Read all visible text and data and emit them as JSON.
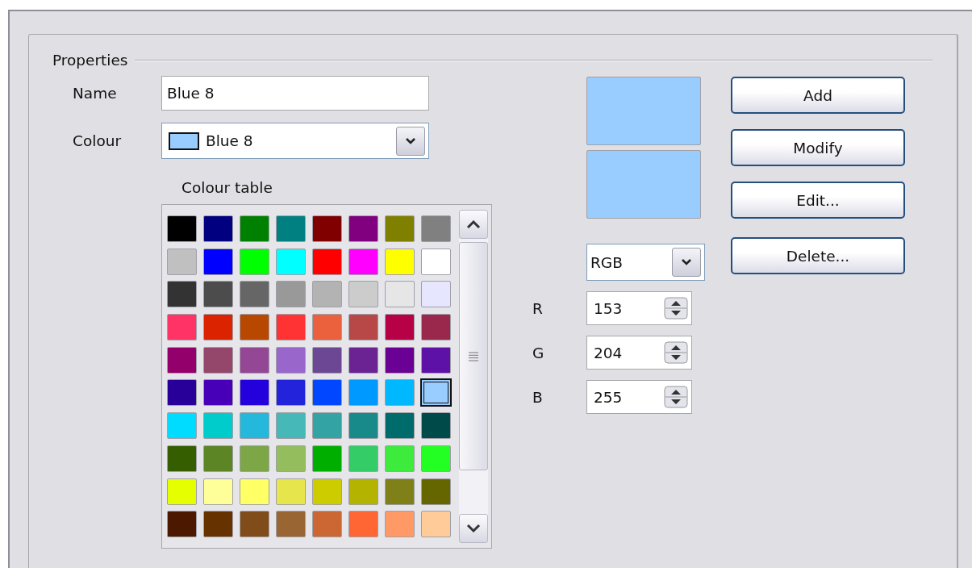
{
  "group": {
    "title": "Properties"
  },
  "name_field": {
    "label": "Name",
    "value": "Blue 8"
  },
  "colour_dropdown": {
    "label": "Colour",
    "value": "Blue 8",
    "color": "#99ccff"
  },
  "colour_table": {
    "label": "Colour table",
    "rows": [
      {
        "cells": [
          {
            "color": "#000000",
            "selected": false
          },
          {
            "color": "#000080",
            "selected": false
          },
          {
            "color": "#008000",
            "selected": false
          },
          {
            "color": "#008080",
            "selected": false
          },
          {
            "color": "#800000",
            "selected": false
          },
          {
            "color": "#800080",
            "selected": false
          },
          {
            "color": "#808000",
            "selected": false
          },
          {
            "color": "#808080",
            "selected": false
          }
        ]
      },
      {
        "cells": [
          {
            "color": "#c0c0c0",
            "selected": false
          },
          {
            "color": "#0000ff",
            "selected": false
          },
          {
            "color": "#00ff00",
            "selected": false
          },
          {
            "color": "#00ffff",
            "selected": false
          },
          {
            "color": "#ff0000",
            "selected": false
          },
          {
            "color": "#ff00ff",
            "selected": false
          },
          {
            "color": "#ffff00",
            "selected": false
          },
          {
            "color": "#ffffff",
            "selected": false
          }
        ]
      },
      {
        "cells": [
          {
            "color": "#333333",
            "selected": false
          },
          {
            "color": "#4c4c4c",
            "selected": false
          },
          {
            "color": "#666666",
            "selected": false
          },
          {
            "color": "#999999",
            "selected": false
          },
          {
            "color": "#b3b3b3",
            "selected": false
          },
          {
            "color": "#cccccc",
            "selected": false
          },
          {
            "color": "#e6e6e6",
            "selected": false
          },
          {
            "color": "#e6e6ff",
            "selected": false
          }
        ]
      },
      {
        "cells": [
          {
            "color": "#ff3366",
            "selected": false
          },
          {
            "color": "#dc2300",
            "selected": false
          },
          {
            "color": "#b84700",
            "selected": false
          },
          {
            "color": "#ff3333",
            "selected": false
          },
          {
            "color": "#eb613d",
            "selected": false
          },
          {
            "color": "#b84747",
            "selected": false
          },
          {
            "color": "#b80047",
            "selected": false
          },
          {
            "color": "#99284c",
            "selected": false
          }
        ]
      },
      {
        "cells": [
          {
            "color": "#94006b",
            "selected": false
          },
          {
            "color": "#94476b",
            "selected": false
          },
          {
            "color": "#944794",
            "selected": false
          },
          {
            "color": "#9966cc",
            "selected": false
          },
          {
            "color": "#6b4794",
            "selected": false
          },
          {
            "color": "#6b2394",
            "selected": false
          },
          {
            "color": "#6b0094",
            "selected": false
          },
          {
            "color": "#5e11a6",
            "selected": false
          }
        ]
      },
      {
        "cells": [
          {
            "color": "#280099",
            "selected": false
          },
          {
            "color": "#4700b8",
            "selected": false
          },
          {
            "color": "#2300dc",
            "selected": false
          },
          {
            "color": "#2323dc",
            "selected": false
          },
          {
            "color": "#0047ff",
            "selected": false
          },
          {
            "color": "#0099ff",
            "selected": false
          },
          {
            "color": "#00b8ff",
            "selected": false
          },
          {
            "color": "#99ccff",
            "selected": true
          }
        ]
      },
      {
        "cells": [
          {
            "color": "#00dcff",
            "selected": false
          },
          {
            "color": "#00cccc",
            "selected": false
          },
          {
            "color": "#23b8dc",
            "selected": false
          },
          {
            "color": "#47b8b8",
            "selected": false
          },
          {
            "color": "#33a3a3",
            "selected": false
          },
          {
            "color": "#198a8a",
            "selected": false
          },
          {
            "color": "#006b6b",
            "selected": false
          },
          {
            "color": "#004a4a",
            "selected": false
          }
        ]
      },
      {
        "cells": [
          {
            "color": "#355e00",
            "selected": false
          },
          {
            "color": "#5c8526",
            "selected": false
          },
          {
            "color": "#7da647",
            "selected": false
          },
          {
            "color": "#94bd5e",
            "selected": false
          },
          {
            "color": "#00ae00",
            "selected": false
          },
          {
            "color": "#33cc66",
            "selected": false
          },
          {
            "color": "#3deb3d",
            "selected": false
          },
          {
            "color": "#23ff23",
            "selected": false
          }
        ]
      },
      {
        "cells": [
          {
            "color": "#e6ff00",
            "selected": false
          },
          {
            "color": "#ffff99",
            "selected": false
          },
          {
            "color": "#ffff66",
            "selected": false
          },
          {
            "color": "#e6e64c",
            "selected": false
          },
          {
            "color": "#cccc00",
            "selected": false
          },
          {
            "color": "#b3b300",
            "selected": false
          },
          {
            "color": "#808019",
            "selected": false
          },
          {
            "color": "#666600",
            "selected": false
          }
        ]
      },
      {
        "cells": [
          {
            "color": "#4c1900",
            "selected": false
          },
          {
            "color": "#663300",
            "selected": false
          },
          {
            "color": "#804c19",
            "selected": false
          },
          {
            "color": "#996633",
            "selected": false
          },
          {
            "color": "#cc6633",
            "selected": false
          },
          {
            "color": "#ff6633",
            "selected": false
          },
          {
            "color": "#ff9966",
            "selected": false
          },
          {
            "color": "#ffcc99",
            "selected": false
          }
        ]
      }
    ]
  },
  "previews": [
    {
      "color": "#99ccff"
    },
    {
      "color": "#99ccff"
    }
  ],
  "model_dropdown": {
    "value": "RGB"
  },
  "channels": [
    {
      "label": "R",
      "value": "153"
    },
    {
      "label": "G",
      "value": "204"
    },
    {
      "label": "B",
      "value": "255"
    }
  ],
  "buttons": [
    {
      "label": "Add"
    },
    {
      "label": "Modify"
    },
    {
      "label": "Edit..."
    },
    {
      "label": "Delete..."
    }
  ]
}
